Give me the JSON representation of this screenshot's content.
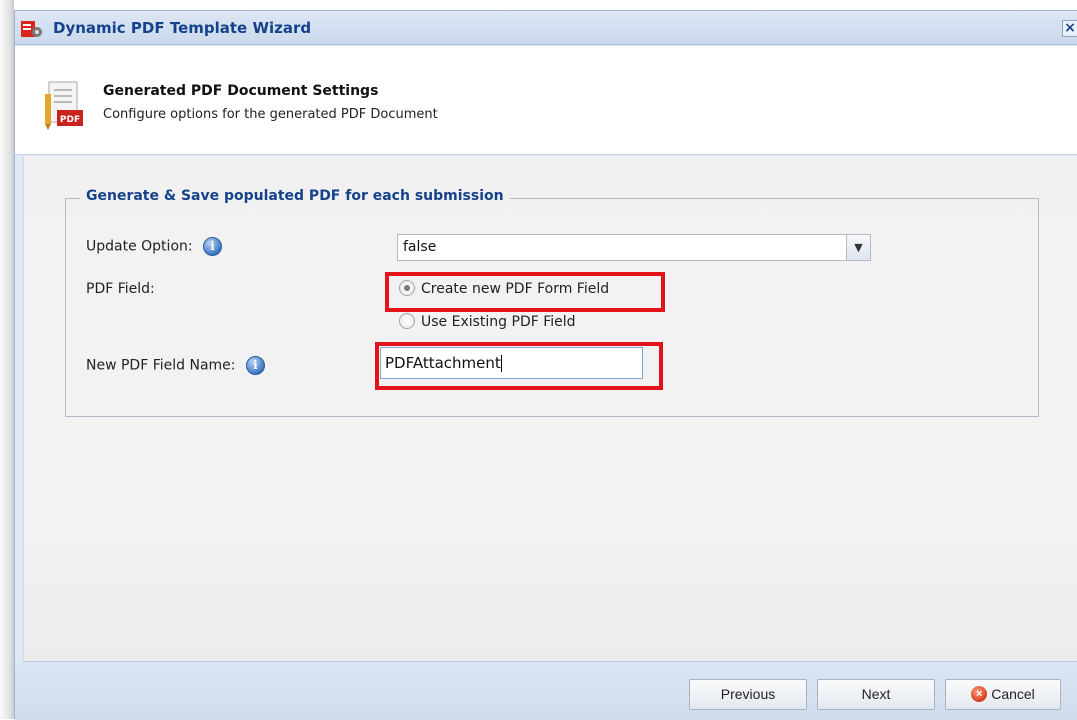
{
  "window": {
    "title": "Dynamic PDF Template Wizard",
    "close_label": "×"
  },
  "header": {
    "title": "Generated PDF Document Settings",
    "subtitle": "Configure options for the generated PDF Document",
    "icon_text": "PDF"
  },
  "fieldset": {
    "legend": "Generate & Save populated PDF for each submission",
    "update_option": {
      "label": "Update Option:",
      "value": "false"
    },
    "pdf_field": {
      "label": "PDF Field:",
      "options": [
        {
          "label": "Create new PDF Form Field",
          "checked": true
        },
        {
          "label": "Use Existing PDF Field",
          "checked": false
        }
      ]
    },
    "new_field_name": {
      "label": "New PDF Field Name:",
      "value": "PDFAttachment"
    }
  },
  "footer": {
    "previous_label": "Previous",
    "next_label": "Next",
    "cancel_label": "Cancel"
  },
  "colors": {
    "title_blue": "#15428b",
    "highlight_red": "#e2131b"
  },
  "icons": [
    "app-icon",
    "close-icon",
    "pdf-document-icon",
    "info-icon",
    "dropdown-arrow-icon",
    "cancel-icon"
  ]
}
